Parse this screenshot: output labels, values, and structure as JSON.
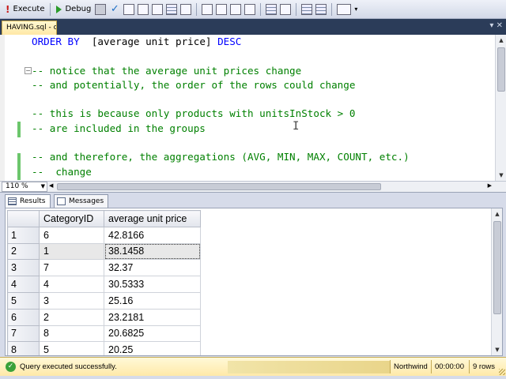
{
  "toolbar": {
    "execute_label": "Execute",
    "debug_label": "Debug",
    "items": [
      "stop-icon",
      "check-icon",
      "parse-icon",
      "results-to-text-icon",
      "results-to-grid-icon",
      "results-to-file-icon",
      "query-options-icon",
      "comment-icon",
      "uncomment-icon",
      "decrease-indent-icon",
      "increase-indent-icon",
      "specify-values-icon"
    ]
  },
  "tabs": {
    "doc_tab_label": "HAVING.sql - c"
  },
  "editor": {
    "zoom": "110 %",
    "lines": [
      [
        {
          "t": "kw",
          "v": "ORDER BY"
        },
        {
          "t": "id",
          "v": "  [average unit price] "
        },
        {
          "t": "kw",
          "v": "DESC"
        }
      ],
      [],
      [
        {
          "t": "cm",
          "v": "-- notice that the average unit prices change"
        }
      ],
      [
        {
          "t": "cm",
          "v": "-- and potentially, the order of the rows could change"
        }
      ],
      [],
      [
        {
          "t": "cm",
          "v": "-- this is because only products with unitsInStock > 0"
        }
      ],
      [
        {
          "t": "cm",
          "v": "-- are included in the groups"
        }
      ],
      [],
      [
        {
          "t": "cm",
          "v": "-- and therefore, the aggregations (AVG, MIN, MAX, COUNT, etc.)"
        }
      ],
      [
        {
          "t": "cm",
          "v": "--  change"
        }
      ]
    ]
  },
  "results_tabs": {
    "results_label": "Results",
    "messages_label": "Messages"
  },
  "grid": {
    "columns": [
      "CategoryID",
      "average unit price"
    ],
    "rows": [
      {
        "n": "1",
        "cat": "6",
        "avg": "42.8166"
      },
      {
        "n": "2",
        "cat": "1",
        "avg": "38.1458"
      },
      {
        "n": "3",
        "cat": "7",
        "avg": "32.37"
      },
      {
        "n": "4",
        "cat": "4",
        "avg": "30.5333"
      },
      {
        "n": "5",
        "cat": "3",
        "avg": "25.16"
      },
      {
        "n": "6",
        "cat": "2",
        "avg": "23.2181"
      },
      {
        "n": "7",
        "cat": "8",
        "avg": "20.6825"
      },
      {
        "n": "8",
        "cat": "5",
        "avg": "20.25"
      }
    ],
    "selected_row": 1
  },
  "status": {
    "message": "Query executed successfully.",
    "database": "Northwind",
    "elapsed": "00:00:00",
    "rows": "9 rows",
    "bar_color": "#ffe9a8"
  }
}
